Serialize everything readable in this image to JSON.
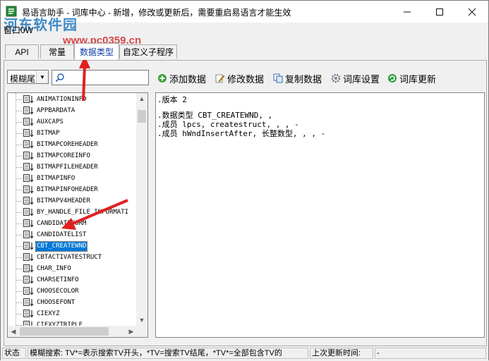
{
  "window": {
    "title": "易语言助手 - 词库中心 - 新增，修改或更新后，需要重启易语言才能生效",
    "menu_label": "窗口0W",
    "watermark_logo": "河东软件园",
    "watermark_url": "www.pc0359.cn"
  },
  "tabs": [
    {
      "label": "API"
    },
    {
      "label": "常量"
    },
    {
      "label": "数据类型",
      "active": true
    },
    {
      "label": "自定义子程序"
    }
  ],
  "search": {
    "mode_value": "模糊尾",
    "input_value": ""
  },
  "toolbar": {
    "add": "添加数据",
    "edit": "修改数据",
    "copy": "复制数据",
    "settings": "词库设置",
    "update": "词库更新"
  },
  "tree": {
    "items": [
      "ANIMATIONINFO",
      "APPBARDATA",
      "AUXCAPS",
      "BITMAP",
      "BITMAPCOREHEADER",
      "BITMAPCOREINFO",
      "BITMAPFILEHEADER",
      "BITMAPINFO",
      "BITMAPINFOHEADER",
      "BITMAPV4HEADER",
      "BY_HANDLE_FILE_INFORMATI",
      "CANDIDATEFORM",
      "CANDIDATELIST",
      "CBT_CREATEWND",
      "CBTACTIVATESTRUCT",
      "CHAR_INFO",
      "CHARSETINFO",
      "CHOOSECOLOR",
      "CHOOSEFONT",
      "CIEXYZ",
      "CIEXYZTRIPLE"
    ],
    "selected": "CBT_CREATEWND"
  },
  "editor": {
    "lines": [
      ".版本 2",
      "",
      ".数据类型 CBT_CREATEWND, ,",
      ".成员 lpcs, createstruct, , , -",
      ".成员 hWndInsertAfter, 长整数型, , , -"
    ]
  },
  "statusbar": {
    "label": "状态",
    "message": "模糊搜索: TV*=表示搜索TV开头，*TV=搜索TV结尾，*TV*=全部包含TV的",
    "last_update_label": "上次更新时间:",
    "last_update_value": "-"
  },
  "colors": {
    "selection": "#0078d7",
    "annotation_arrow": "#e02020",
    "active_tab_text": "#0b3ea8"
  }
}
